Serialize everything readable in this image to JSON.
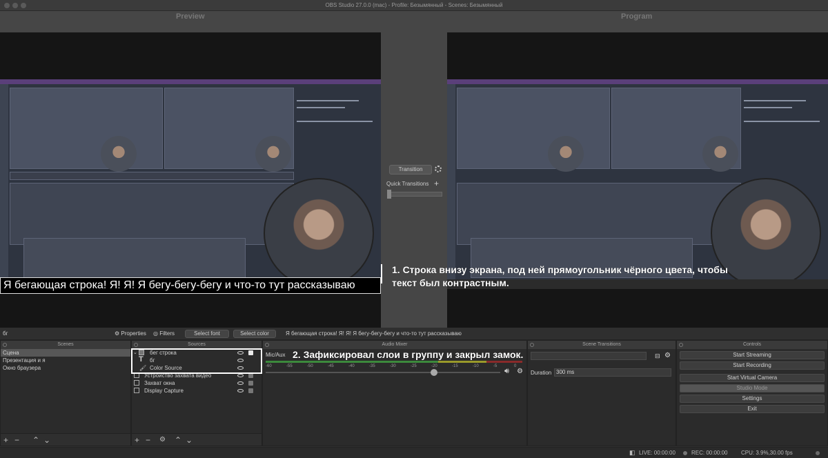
{
  "window": {
    "title": "OBS Studio 27.0.0 (mac) - Profile: Безымянный - Scenes: Безымянный"
  },
  "preview": {
    "label": "Preview",
    "ticker_text": "Я бегающая строка! Я! Я! Я бегу-бегу-бегу и что-то тут рассказываю"
  },
  "program": {
    "label": "Program"
  },
  "transition": {
    "button": "Transition",
    "quick_label": "Quick Transitions",
    "quick_add": "+"
  },
  "annotations": {
    "note1": "1. Строка внизу экрана, под ней прямоугольник чёрного цвета, чтобы текст был контрастным.",
    "note2": "2. Зафиксировал слои в группу и закрыл замок."
  },
  "source_toolbar": {
    "selected_source": "бг",
    "properties": "Properties",
    "filters": "Filters",
    "select_font": "Select font",
    "select_color": "Select color",
    "text_value": "Я бегающая строка! Я! Я! Я бегу-бегу-бегу и что-то тут рассказываю"
  },
  "docks": {
    "scenes": "Scenes",
    "sources": "Sources",
    "audio_mixer": "Audio Mixer",
    "scene_transitions": "Scene Transitions",
    "controls": "Controls"
  },
  "scenes": [
    {
      "label": "Сцена",
      "selected": true
    },
    {
      "label": "Презентация и я",
      "selected": false
    },
    {
      "label": "Окно браузера",
      "selected": false
    }
  ],
  "sources": [
    {
      "label": "бег строка",
      "icon": "folder-icon",
      "group": true,
      "locked": true
    },
    {
      "label": "бг",
      "icon": "text-icon",
      "child": true,
      "locked": false
    },
    {
      "label": "Color Source",
      "icon": "brush-icon",
      "child": true,
      "locked": false
    },
    {
      "label": "Устройство захвата видео",
      "icon": "camera-icon",
      "locked": false
    },
    {
      "label": "Захват окна",
      "icon": "window-icon",
      "locked": false
    },
    {
      "label": "Display Capture",
      "icon": "monitor-icon",
      "locked": false
    }
  ],
  "mixer": {
    "channel": "Mic/Aux",
    "scale": [
      "-60",
      "-55",
      "-50",
      "-45",
      "-40",
      "-35",
      "-30",
      "-25",
      "-20",
      "-15",
      "-10",
      "-5",
      "0"
    ]
  },
  "scene_transitions": {
    "duration_label": "Duration",
    "duration_value": "300 ms"
  },
  "controls": [
    {
      "label": "Start Streaming",
      "active": false
    },
    {
      "label": "Start Recording",
      "active": false
    },
    {
      "label": "Start Virtual Camera",
      "active": false
    },
    {
      "label": "Studio Mode",
      "active": true
    },
    {
      "label": "Settings",
      "active": false
    },
    {
      "label": "Exit",
      "active": false
    }
  ],
  "status": {
    "live": "LIVE: 00:00:00",
    "rec": "REC: 00:00:00",
    "cpu": "CPU: 3.9%,30.00 fps"
  },
  "colors": {
    "accent": "#5a3f7a",
    "meter_green": "#3c8a3c",
    "meter_yellow": "#9a9a2a",
    "meter_red": "#8a2a2a"
  }
}
